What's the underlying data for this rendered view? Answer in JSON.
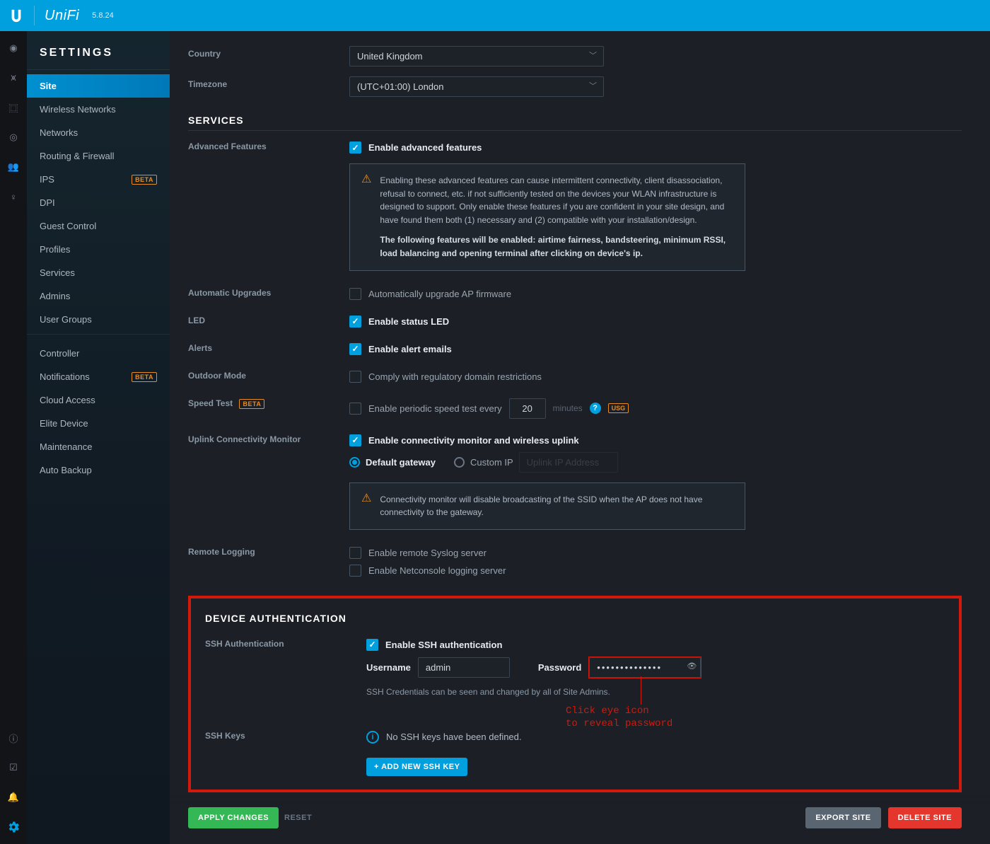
{
  "topbar": {
    "brand": "UniFi",
    "version": "5.8.24"
  },
  "sidebar": {
    "title": "SETTINGS",
    "items": [
      {
        "label": "Site",
        "active": true
      },
      {
        "label": "Wireless Networks"
      },
      {
        "label": "Networks"
      },
      {
        "label": "Routing & Firewall"
      },
      {
        "label": "IPS",
        "beta": true
      },
      {
        "label": "DPI"
      },
      {
        "label": "Guest Control"
      },
      {
        "label": "Profiles"
      },
      {
        "label": "Services"
      },
      {
        "label": "Admins"
      },
      {
        "label": "User Groups"
      }
    ],
    "items2": [
      {
        "label": "Controller"
      },
      {
        "label": "Notifications",
        "beta": true
      },
      {
        "label": "Cloud Access"
      },
      {
        "label": "Elite Device"
      },
      {
        "label": "Maintenance"
      },
      {
        "label": "Auto Backup"
      }
    ],
    "beta_text": "BETA"
  },
  "form": {
    "country_label": "Country",
    "country_value": "United Kingdom",
    "timezone_label": "Timezone",
    "timezone_value": "(UTC+01:00) London",
    "services_heading": "SERVICES",
    "advanced_label": "Advanced Features",
    "advanced_chk": "Enable advanced features",
    "advanced_warn1": "Enabling these advanced features can cause intermittent connectivity, client disassociation, refusal to connect, etc. if not sufficiently tested on the devices your WLAN infrastructure is designed to support. Only enable these features if you are confident in your site design, and have found them both (1) necessary and (2) compatible with your installation/design.",
    "advanced_warn2": "The following features will be enabled: airtime fairness, bandsteering, minimum RSSI, load balancing and opening terminal after clicking on device's ip.",
    "auto_upg_label": "Automatic Upgrades",
    "auto_upg_chk": "Automatically upgrade AP firmware",
    "led_label": "LED",
    "led_chk": "Enable status LED",
    "alerts_label": "Alerts",
    "alerts_chk": "Enable alert emails",
    "outdoor_label": "Outdoor Mode",
    "outdoor_chk": "Comply with regulatory domain restrictions",
    "speed_label": "Speed Test",
    "speed_chk": "Enable periodic speed test every",
    "speed_value": "20",
    "speed_unit": "minutes",
    "usg_tag": "USG",
    "uplink_label": "Uplink Connectivity Monitor",
    "uplink_chk": "Enable connectivity monitor and wireless uplink",
    "uplink_opt1": "Default gateway",
    "uplink_opt2": "Custom IP",
    "uplink_ip_placeholder": "Uplink IP Address",
    "uplink_warn": "Connectivity monitor will disable broadcasting of the SSID when the AP does not have connectivity to the gateway.",
    "remote_label": "Remote Logging",
    "remote_chk1": "Enable remote Syslog server",
    "remote_chk2": "Enable Netconsole logging server",
    "devauth_heading": "DEVICE AUTHENTICATION",
    "ssh_label": "SSH Authentication",
    "ssh_chk": "Enable SSH authentication",
    "ssh_user_label": "Username",
    "ssh_user_value": "admin",
    "ssh_pw_label": "Password",
    "ssh_pw_value": "••••••••••••••",
    "ssh_note": "SSH Credentials can be seen and changed by all of Site Admins.",
    "sshkeys_label": "SSH Keys",
    "sshkeys_none": "No SSH keys have been defined.",
    "sshkeys_add": "+  ADD NEW SSH KEY"
  },
  "annotation": {
    "line1": "Click eye icon",
    "line2": "to reveal password"
  },
  "footer": {
    "apply": "APPLY CHANGES",
    "reset": "RESET",
    "export": "EXPORT SITE",
    "delete": "DELETE SITE"
  }
}
